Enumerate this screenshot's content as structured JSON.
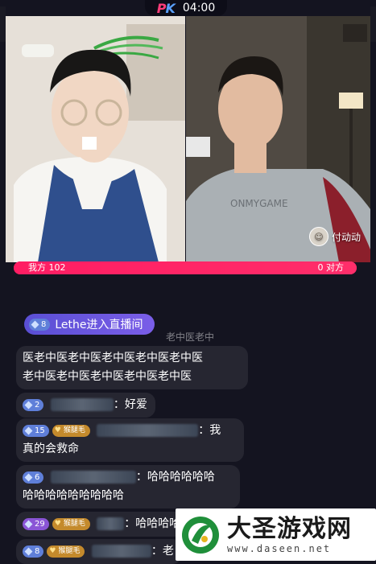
{
  "pk": {
    "logo_p": "P",
    "logo_k": "K",
    "timer": "04:00"
  },
  "guest": {
    "name": "付动动"
  },
  "score": {
    "left_label": "我方 102",
    "right_label": "0 对方",
    "left_value": 102,
    "right_value": 0
  },
  "chat": {
    "enter": {
      "level": "8",
      "text": "Lethe进入直播间"
    },
    "partial_line": "老中医老中",
    "repeat_line1": "医老中医老中医老中医老中医老中医",
    "repeat_line2": "老中医老中医老中医老中医老中医",
    "messages": [
      {
        "level": "2",
        "text": "：好爱"
      },
      {
        "level": "15",
        "fan": "猴腿毛",
        "text_a": "：我",
        "text_b": "真的会救命"
      },
      {
        "level": "6",
        "text_a": "：哈哈哈哈哈哈",
        "text_b": "哈哈哈哈哈哈哈哈哈"
      },
      {
        "level": "29",
        "fan": "猴腿毛",
        "text": "：哈哈哈哈"
      },
      {
        "level": "8",
        "fan": "猴腿毛",
        "text": "：老"
      }
    ]
  },
  "watermark": {
    "title": "大圣游戏网",
    "url": "www.daseen.net"
  }
}
